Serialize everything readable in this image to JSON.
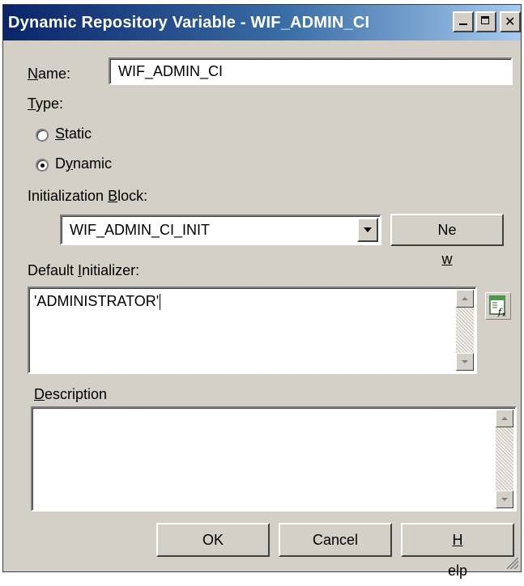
{
  "window": {
    "title": "Dynamic Repository Variable - WIF_ADMIN_CI"
  },
  "name_field": {
    "label": "Name:",
    "label_hotkey": "N",
    "label_rest": "ame:",
    "value": "WIF_ADMIN_CI"
  },
  "type_group": {
    "label_hotkey": "T",
    "label_rest": "ype:",
    "options": [
      {
        "hotkey_pre": "",
        "hotkey": "S",
        "rest": "tatic",
        "label": "Static",
        "selected": false
      },
      {
        "hotkey_pre": "D",
        "hotkey": "y",
        "rest": "namic",
        "label": "Dynamic",
        "selected": true
      }
    ]
  },
  "init_block": {
    "label_pre": "Initialization ",
    "label_hotkey": "B",
    "label_rest": "lock:",
    "selected": "WIF_ADMIN_CI_INIT",
    "new_button_pre": "Ne",
    "new_button_hotkey": "w",
    "new_button_rest": "..."
  },
  "default_initializer": {
    "label_pre": "Default ",
    "label_hotkey": "I",
    "label_rest": "nitializer:",
    "value": "'ADMINISTRATOR'",
    "expression_icon": "expression-builder-icon"
  },
  "description": {
    "label_hotkey": "D",
    "label_rest": "escription",
    "value": ""
  },
  "buttons": {
    "ok": "OK",
    "cancel": "Cancel",
    "help_hotkey": "H",
    "help_rest": "elp"
  },
  "icons": {
    "minimize": "minimize-icon",
    "maximize": "maximize-icon",
    "close": "close-icon"
  },
  "colors": {
    "dialog_bg": "#d4d0c8",
    "title_start": "#0a246a",
    "title_end": "#a6caf0"
  }
}
